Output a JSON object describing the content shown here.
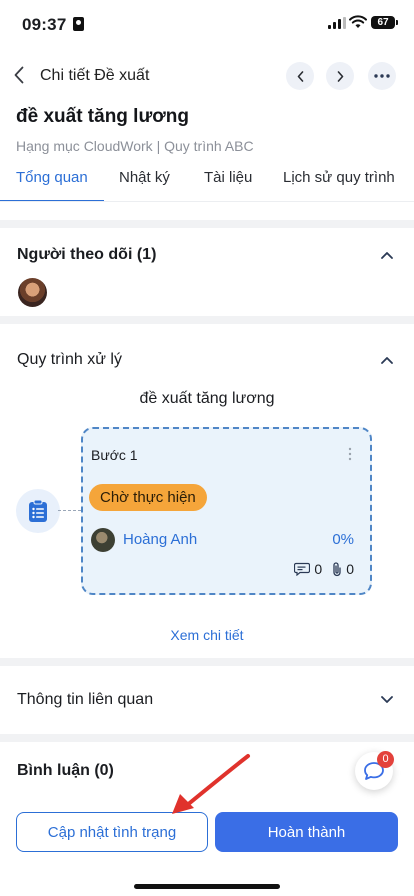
{
  "status_bar": {
    "time": "09:37",
    "battery": "67"
  },
  "header": {
    "title": "Chi tiết Đề xuất",
    "doc_title": "đề xuất tăng lương",
    "doc_subtitle": "Hạng mục CloudWork | Quy trình ABC"
  },
  "tabs": [
    {
      "label": "Tổng quan",
      "active": true
    },
    {
      "label": "Nhật ký",
      "active": false
    },
    {
      "label": "Tài liệu",
      "active": false
    },
    {
      "label": "Lịch sử quy trình",
      "active": false
    }
  ],
  "followers": {
    "title": "Người theo dõi (1)"
  },
  "process": {
    "title": "Quy trình xử lý",
    "flow_name": "đề xuất tăng lương",
    "step": {
      "label": "Bước 1",
      "status": "Chờ thực hiện",
      "assignee": "Hoàng Anh",
      "progress": "0%",
      "comments": "0",
      "attachments": "0"
    },
    "see_more": "Xem chi tiết"
  },
  "related": {
    "title": "Thông tin liên quan"
  },
  "comments": {
    "title": "Bình luận (0)",
    "badge": "0"
  },
  "footer": {
    "update_label": "Cập nhật tình trạng",
    "done_label": "Hoàn thành"
  },
  "colors": {
    "primary": "#2c6fd6",
    "done_button": "#3a6ee6",
    "status_pill": "#f5a53a",
    "badge": "#e3413b",
    "arrow": "#e0322c"
  }
}
